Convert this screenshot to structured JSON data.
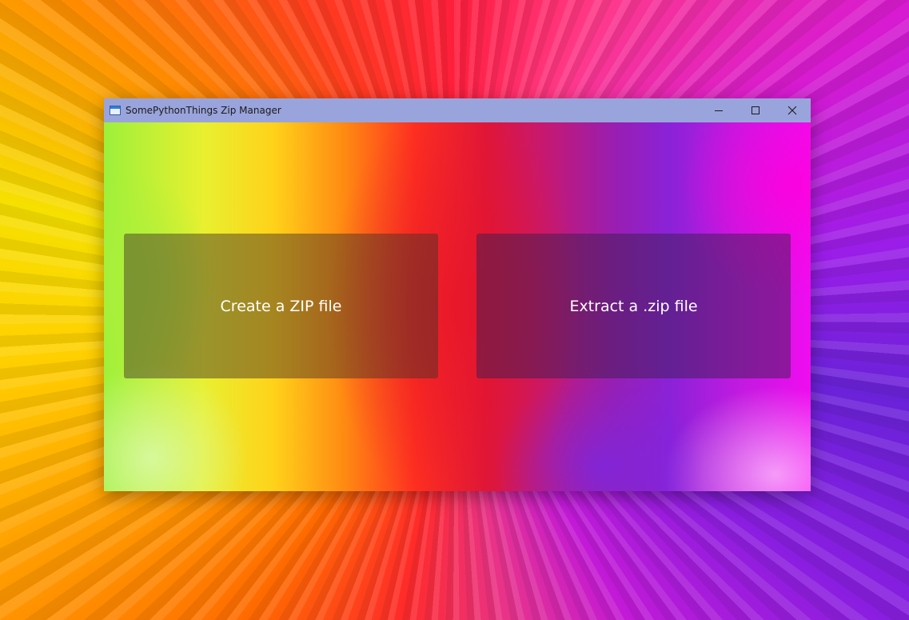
{
  "window": {
    "title": "SomePythonThings Zip Manager",
    "title_bar_color": "#9aa4dc",
    "icons": {
      "app": "app-icon",
      "minimize": "minimize-icon",
      "maximize": "maximize-icon",
      "close": "close-icon"
    }
  },
  "main": {
    "create_label": "Create a ZIP file",
    "extract_label": "Extract a .zip file"
  }
}
